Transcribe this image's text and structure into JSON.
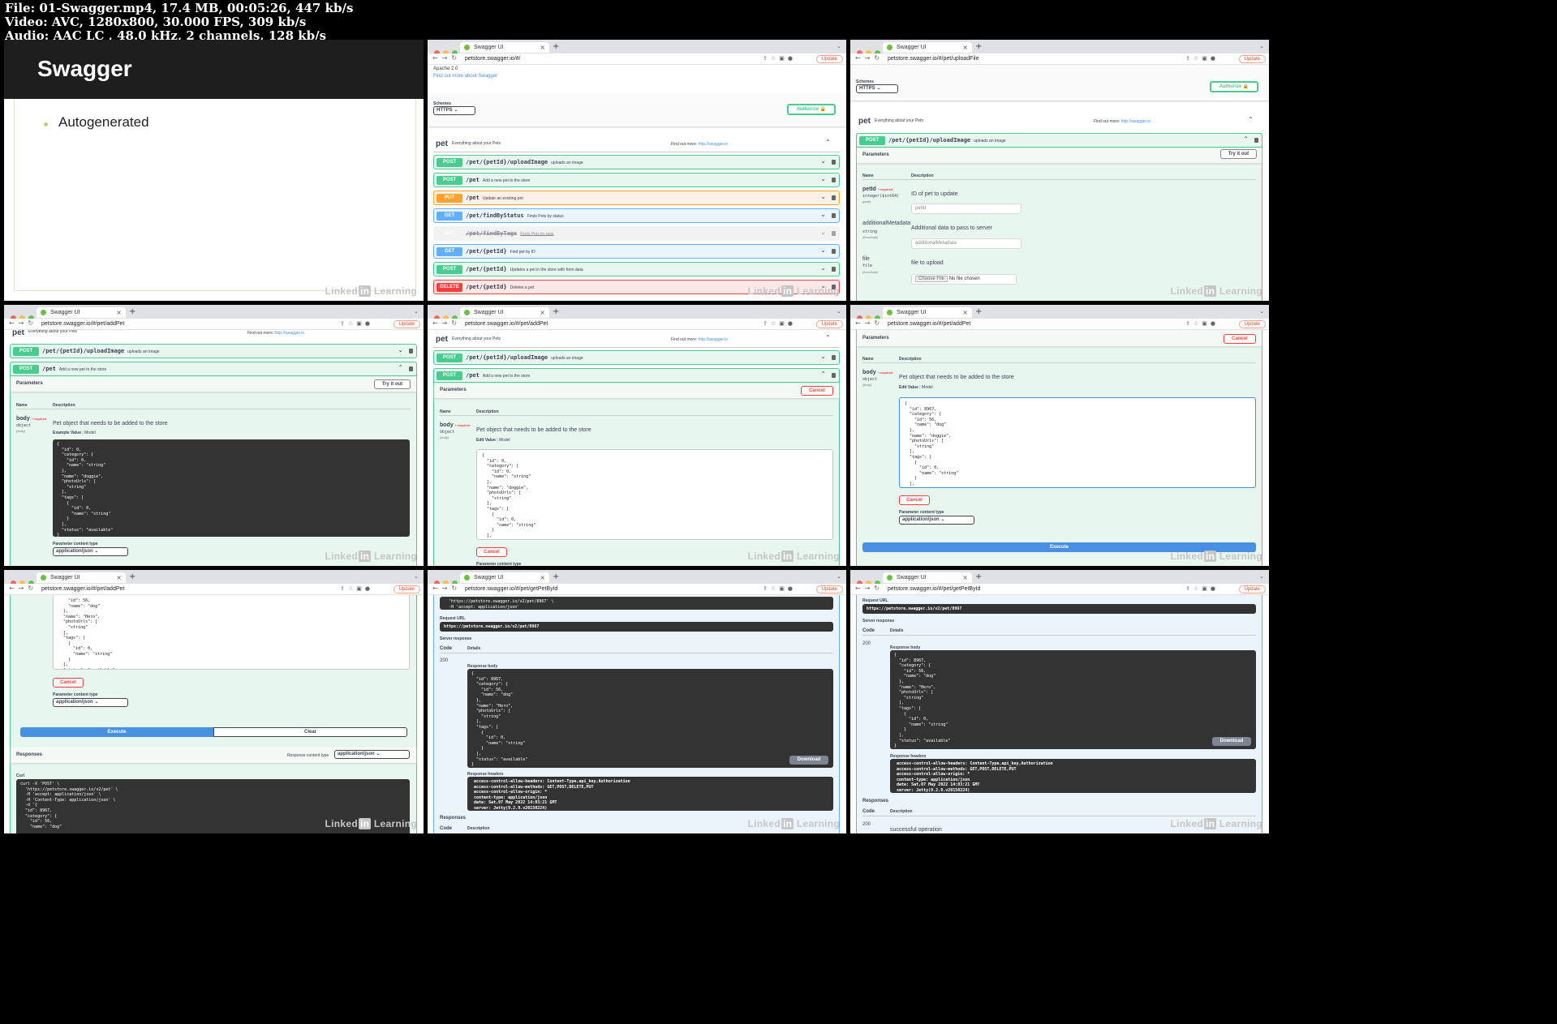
{
  "file_info": {
    "line1": "File: 01-Swagger.mp4, 17.4 MB, 00:05:26, 447 kb/s",
    "line2": "Video: AVC, 1280x800, 30.000 FPS, 309 kb/s",
    "line3": "Audio: AAC LC , 48.0 kHz, 2 channels, 128 kb/s"
  },
  "watermark": {
    "pre": "Linked",
    "mark": "in",
    "post": " Learning"
  },
  "slide": {
    "title": "Swagger",
    "bullet": "Autogenerated"
  },
  "browser": {
    "tab_title": "Swagger UI",
    "update": "Update",
    "urls": [
      "petstore.swagger.io/#/",
      "petstore.swagger.io/#/pet/uploadFile",
      "petstore.swagger.io/#/pet/addPet",
      "petstore.swagger.io/#/pet/addPet",
      "petstore.swagger.io/#/pet/addPet",
      "petstore.swagger.io/#/pet/addPet",
      "petstore.swagger.io/#/pet/getPetById",
      "petstore.swagger.io/#/pet/getPetById"
    ]
  },
  "swagger": {
    "license": "Apache 2.0",
    "find_out": "Find out more about Swagger",
    "schemes_label": "Schemes",
    "scheme": "HTTPS",
    "authorize": "Authorize",
    "tag": "pet",
    "tag_desc": "Everything about your Pets",
    "find_more": "Find out more:",
    "find_more_url": "http://swagger.io",
    "ops": [
      {
        "method": "POST",
        "path": "/pet/{petId}/uploadImage",
        "summary": "uploads an image"
      },
      {
        "method": "POST",
        "path": "/pet",
        "summary": "Add a new pet to the store"
      },
      {
        "method": "PUT",
        "path": "/pet",
        "summary": "Update an existing pet"
      },
      {
        "method": "GET",
        "path": "/pet/findByStatus",
        "summary": "Finds Pets by status"
      },
      {
        "method": "GET",
        "path": "/pet/findByTags",
        "summary": "Finds Pets by tags"
      },
      {
        "method": "GET",
        "path": "/pet/{petId}",
        "summary": "Find pet by ID"
      },
      {
        "method": "POST",
        "path": "/pet/{petId}",
        "summary": "Updates a pet in the store with form data"
      },
      {
        "method": "DELETE",
        "path": "/pet/{petId}",
        "summary": "Deletes a pet"
      }
    ],
    "parameters": "Parameters",
    "try_it_out": "Try it out",
    "cancel": "Cancel",
    "col_name": "Name",
    "col_desc": "Description",
    "required": "* required",
    "petId": {
      "name": "petId",
      "type": "integer($int64)",
      "in": "(path)",
      "desc": "ID of pet to update",
      "placeholder": "petId"
    },
    "additional": {
      "name": "additionalMetadata",
      "type": "string",
      "in": "(formData)",
      "desc": "Additional data to pass to server",
      "placeholder": "additionalMetadata"
    },
    "file": {
      "name": "file",
      "type": "file",
      "in": "(formData)",
      "desc": "file to upload",
      "choose": "Choose File",
      "none": "No file chosen"
    },
    "body": {
      "name": "body",
      "type": "object",
      "in": "(body)",
      "desc": "Pet object that needs to be added to the store"
    },
    "example_value": "Example Value",
    "edit_value": "Edit Value",
    "model": "Model",
    "param_content_type": "Parameter content type",
    "content_type": "application/json",
    "execute": "Execute",
    "clear": "Clear",
    "responses": "Responses",
    "response_content_type": "Response content type",
    "curl": "Curl",
    "request_url": "Request URL",
    "request_url_value": "https://petstore.swagger.io/v2/pet/8967",
    "server_response": "Server response",
    "code": "Code",
    "details": "Details",
    "code_200": "200",
    "response_body": "Response body",
    "response_headers": "Response headers",
    "download": "Download",
    "successful": "successful operation",
    "example_json": "{\n  \"id\": 0,\n  \"category\": {\n    \"id\": 0,\n    \"name\": \"string\"\n  },\n  \"name\": \"doggie\",\n  \"photoUrls\": [\n    \"string\"\n  ],\n  \"tags\": [\n    {\n      \"id\": 0,\n      \"name\": \"string\"\n    }\n  ],\n  \"status\": \"available\"\n}",
    "edit_json": "{\n  \"id\": 8967,\n  \"category\": {\n    \"id\": 56,\n    \"name\": \"dog\"\n  },\n  \"name\": \"doggie\",\n  \"photoUrls\": [\n    \"string\"\n  ],\n  \"tags\": [\n    {\n      \"id\": 0,\n      \"name\": \"string\"\n    }\n  ],\n  \"status\": \"available\"\n}",
    "scrolled_json": "    \"id\": 56,\n    \"name\": \"dog\"\n  },\n  \"name\": \"Hero\",\n  \"photoUrls\": [\n    \"string\"\n  ],\n  \"tags\": [\n    {\n      \"id\": 0,\n      \"name\": \"string\"\n    }\n  ],\n  \"status\": \"available\"\n}",
    "curl_text": "curl -X 'POST' \\\n  'https://petstore.swagger.io/v2/pet' \\\n  -H 'accept: application/json' \\\n  -H 'Content-Type: application/json' \\\n  -d '{\n  \"id\": 8967,\n  \"category\": {\n    \"id\": 56,\n    \"name\": \"dog\"",
    "curl_get": "  'https://petstore.swagger.io/v2/pet/8967' \\\n  -H 'accept: application/json'",
    "response_json": "{\n  \"id\": 8967,\n  \"category\": {\n    \"id\": 56,\n    \"name\": \"dog\"\n  },\n  \"name\": \"Hero\",\n  \"photoUrls\": [\n    \"string\"\n  ],\n  \"tags\": [\n    {\n      \"id\": 0,\n      \"name\": \"string\"\n    }\n  ],\n  \"status\": \"available\"\n}",
    "headers_text": " access-control-allow-headers: Content-Type,api_key,Authorization\n access-control-allow-methods: GET,POST,DELETE,PUT\n access-control-allow-origin: *\n content-type: application/json\n date: Sat,07 May 2022 14:03:21 GMT\n server: Jetty(9.2.9.v20150224)"
  }
}
